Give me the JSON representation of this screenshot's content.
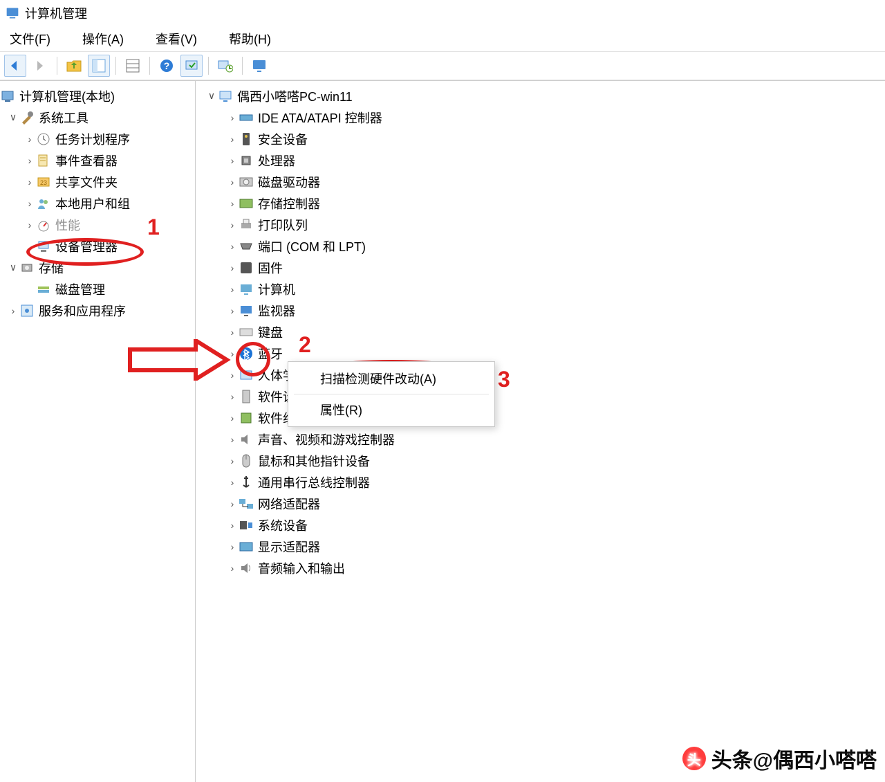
{
  "window": {
    "title": "计算机管理"
  },
  "menus": {
    "file": "文件(F)",
    "action": "操作(A)",
    "view": "查看(V)",
    "help": "帮助(H)"
  },
  "toolbar_icons": {
    "back": "back-arrow-icon",
    "fwd": "forward-arrow-icon",
    "up": "up-folder-icon",
    "props": "properties-pane-icon",
    "list": "list-view-icon",
    "help": "help-icon",
    "scan": "scan-hardware-icon",
    "refresh": "refresh-icon",
    "monitor": "monitor-icon"
  },
  "left_tree": {
    "root": "计算机管理(本地)",
    "system_tools": {
      "label": "系统工具",
      "children": [
        {
          "k": "sched",
          "label": "任务计划程序"
        },
        {
          "k": "event",
          "label": "事件查看器"
        },
        {
          "k": "share",
          "label": "共享文件夹"
        },
        {
          "k": "users",
          "label": "本地用户和组"
        },
        {
          "k": "perf",
          "label": "性能"
        },
        {
          "k": "devmgr",
          "label": "设备管理器"
        }
      ]
    },
    "storage": {
      "label": "存储",
      "children": [
        {
          "k": "diskmgr",
          "label": "磁盘管理"
        }
      ]
    },
    "services": {
      "label": "服务和应用程序"
    }
  },
  "right_tree": {
    "root": "偶西小嗒嗒PC-win11",
    "categories": [
      {
        "k": "ide",
        "label": "IDE ATA/ATAPI 控制器"
      },
      {
        "k": "sec",
        "label": "安全设备"
      },
      {
        "k": "cpu",
        "label": "处理器"
      },
      {
        "k": "drive",
        "label": "磁盘驱动器"
      },
      {
        "k": "storctl",
        "label": "存储控制器"
      },
      {
        "k": "printq",
        "label": "打印队列"
      },
      {
        "k": "ports",
        "label": "端口 (COM 和 LPT)"
      },
      {
        "k": "fw",
        "label": "固件"
      },
      {
        "k": "pc",
        "label": "计算机"
      },
      {
        "k": "mon",
        "label": "监视器"
      },
      {
        "k": "kb",
        "label": "键盘"
      },
      {
        "k": "bt",
        "label": "蓝牙"
      },
      {
        "k": "hid",
        "label": "人体学输入设备"
      },
      {
        "k": "swdev",
        "label": "软件设备"
      },
      {
        "k": "swcomp",
        "label": "软件组件"
      },
      {
        "k": "sound",
        "label": "声音、视频和游戏控制器"
      },
      {
        "k": "mouse",
        "label": "鼠标和其他指针设备"
      },
      {
        "k": "usb",
        "label": "通用串行总线控制器"
      },
      {
        "k": "net",
        "label": "网络适配器"
      },
      {
        "k": "sys",
        "label": "系统设备"
      },
      {
        "k": "disp",
        "label": "显示适配器"
      },
      {
        "k": "audio",
        "label": "音频输入和输出"
      }
    ]
  },
  "context_menu": {
    "scan": "扫描检测硬件改动(A)",
    "props": "属性(R)"
  },
  "annotations": {
    "step1": "1",
    "step2": "2",
    "step3": "3"
  },
  "watermark": "头条@偶西小嗒嗒"
}
